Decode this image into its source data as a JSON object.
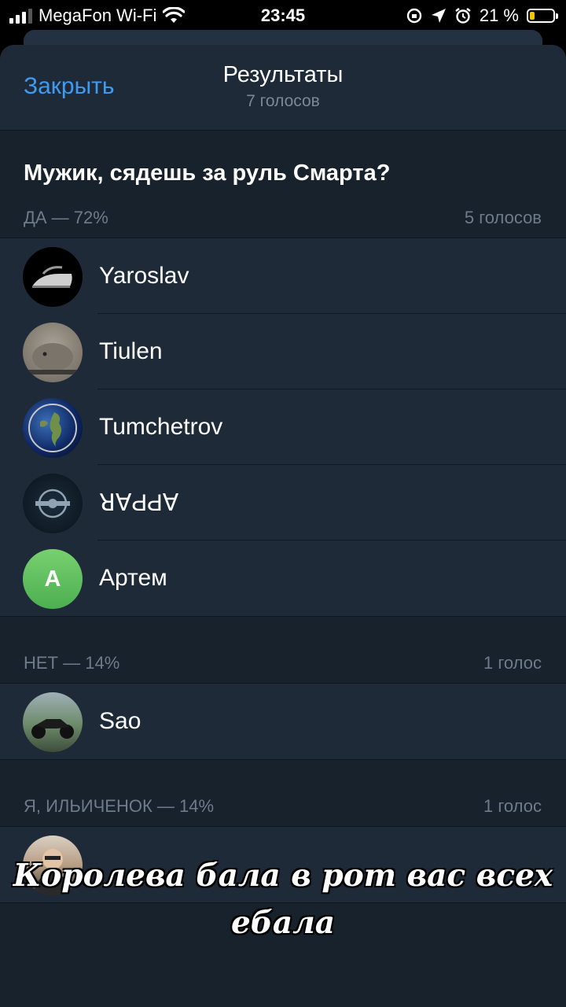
{
  "status_bar": {
    "carrier": "MegaFon Wi-Fi",
    "time": "23:45",
    "battery_percent": "21 %",
    "battery_level": 0.21,
    "battery_color": "#f5c400"
  },
  "header": {
    "close_label": "Закрыть",
    "title": "Результаты",
    "subtitle": "7 голосов"
  },
  "poll": {
    "question": "Мужик, сядешь за руль Смарта?",
    "options": [
      {
        "label": "ДА — 72%",
        "count": "5 голосов",
        "voters": [
          {
            "name": "Yaroslav"
          },
          {
            "name": "Tiulen"
          },
          {
            "name": "Tumchetrov"
          },
          {
            "name": "ꓤ∀ԀԀ∀"
          },
          {
            "name": "Артем",
            "initial": "А"
          }
        ]
      },
      {
        "label": "НЕТ — 14%",
        "count": "1 голос",
        "voters": [
          {
            "name": "Sao"
          }
        ]
      },
      {
        "label": "Я, ИЛЬИЧЕНОК — 14%",
        "count": "1 голос",
        "voters": [
          {
            "name": ""
          }
        ]
      }
    ]
  },
  "overlay_caption": {
    "line1": "Королева бала в рот вас всех",
    "line2": "ебала"
  },
  "colors": {
    "accent": "#3e9bf0",
    "sheet_bg": "#18222d",
    "row_bg": "#1f2a38",
    "secondary_text": "#6f7b8a"
  }
}
